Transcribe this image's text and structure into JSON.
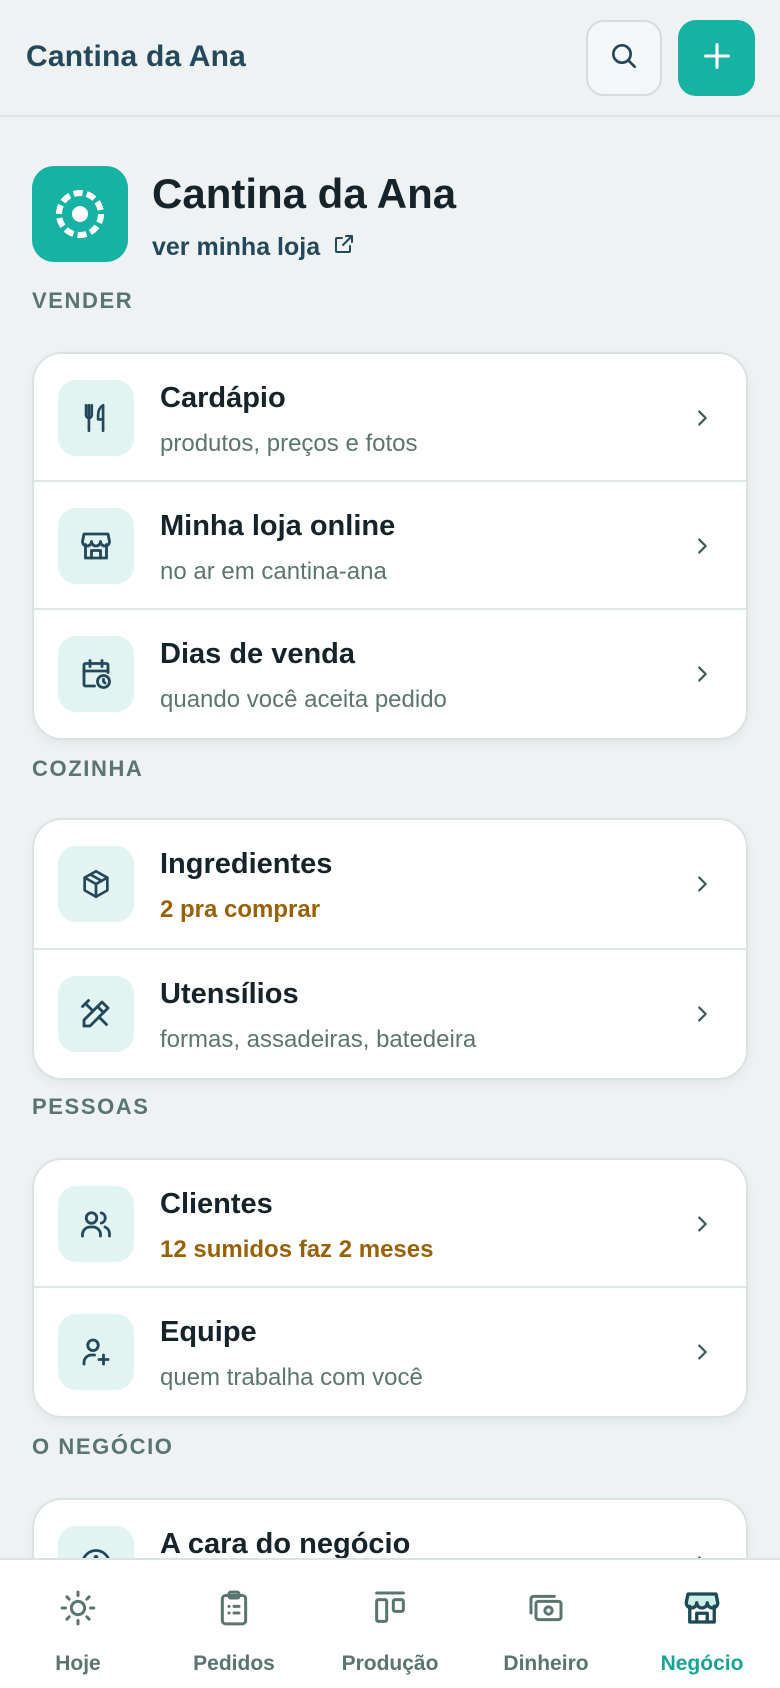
{
  "header": {
    "title": "Cantina da Ana",
    "search_icon": "search-icon",
    "add_icon": "plus-icon"
  },
  "business": {
    "name": "Cantina da Ana",
    "link_label": "ver minha loja",
    "logo_icon": "sun-logo-icon"
  },
  "sections": [
    {
      "label": "VENDER",
      "rows": [
        {
          "title": "Cardápio",
          "subtitle": "produtos, preços e fotos",
          "icon": "utensils-icon",
          "warn": false
        },
        {
          "title": "Minha loja online",
          "subtitle": "no ar em cantina-ana",
          "icon": "store-icon",
          "warn": false
        },
        {
          "title": "Dias de venda",
          "subtitle": "quando você aceita pedido",
          "icon": "calendar-clock-icon",
          "warn": false
        }
      ]
    },
    {
      "label": "COZINHA",
      "rows": [
        {
          "title": "Ingredientes",
          "subtitle": "2 pra comprar",
          "icon": "box-icon",
          "warn": true
        },
        {
          "title": "Utensílios",
          "subtitle": "formas, assadeiras, batedeira",
          "icon": "tools-icon",
          "warn": false
        }
      ]
    },
    {
      "label": "PESSOAS",
      "rows": [
        {
          "title": "Clientes",
          "subtitle": "12 sumidos faz 2 meses",
          "icon": "users-icon",
          "warn": true
        },
        {
          "title": "Equipe",
          "subtitle": "quem trabalha com você",
          "icon": "user-plus-icon",
          "warn": false
        }
      ]
    },
    {
      "label": "O NEGÓCIO",
      "rows": [
        {
          "title": "A cara do negócio",
          "subtitle": "",
          "icon": "info-icon",
          "warn": false
        }
      ]
    }
  ],
  "nav": [
    {
      "label": "Hoje",
      "icon": "sun-icon",
      "active": false
    },
    {
      "label": "Pedidos",
      "icon": "clipboard-icon",
      "active": false
    },
    {
      "label": "Produção",
      "icon": "kanban-icon",
      "active": false
    },
    {
      "label": "Dinheiro",
      "icon": "cash-icon",
      "active": false
    },
    {
      "label": "Negócio",
      "icon": "store-icon",
      "active": true
    }
  ],
  "colors": {
    "accent": "#16b3a4",
    "warn": "#9a6106",
    "nav_active": "#16a596"
  }
}
